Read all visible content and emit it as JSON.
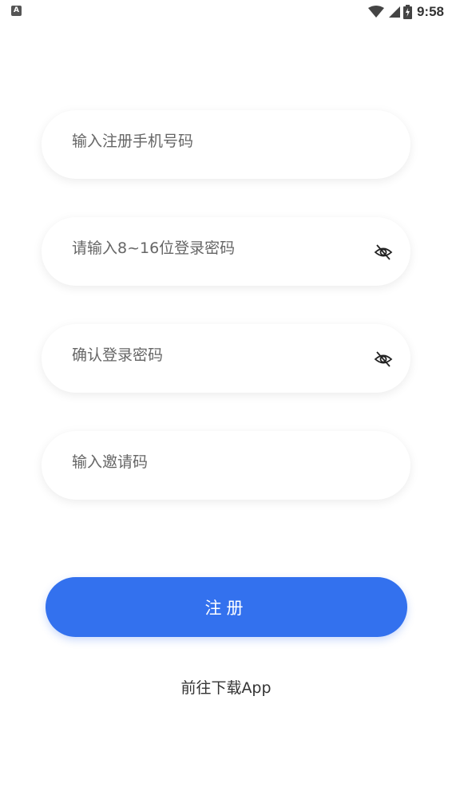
{
  "status_bar": {
    "left_icon": "A",
    "time": "9:58",
    "icons": [
      "wifi-icon",
      "signal-icon",
      "battery-icon"
    ]
  },
  "form": {
    "phone_placeholder": "输入注册手机号码",
    "password_placeholder": "请输入8~16位登录密码",
    "confirm_password_placeholder": "确认登录密码",
    "invite_code_placeholder": "输入邀请码",
    "password_toggle_icon": "eye-off-icon"
  },
  "actions": {
    "register_label": "注册",
    "download_label": "前往下载App"
  },
  "colors": {
    "primary": "#3371EE",
    "background": "#FFFFFF",
    "placeholder": "#666666"
  }
}
